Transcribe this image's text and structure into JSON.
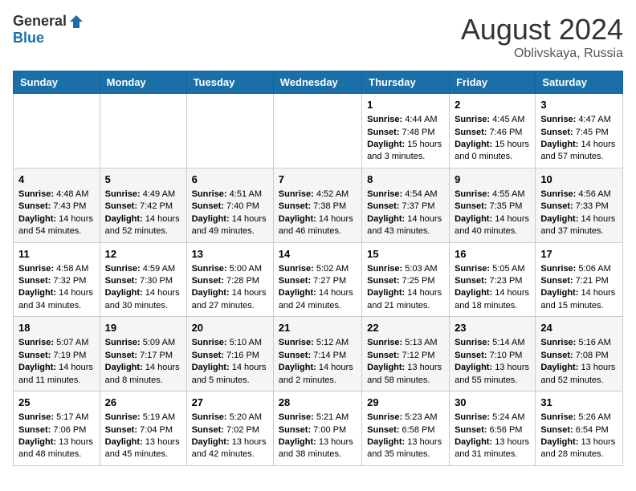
{
  "header": {
    "logo_general": "General",
    "logo_blue": "Blue",
    "month_year": "August 2024",
    "location": "Oblivskaya, Russia"
  },
  "days_of_week": [
    "Sunday",
    "Monday",
    "Tuesday",
    "Wednesday",
    "Thursday",
    "Friday",
    "Saturday"
  ],
  "weeks": [
    [
      {
        "day": "",
        "info": ""
      },
      {
        "day": "",
        "info": ""
      },
      {
        "day": "",
        "info": ""
      },
      {
        "day": "",
        "info": ""
      },
      {
        "day": "1",
        "info": "Sunrise: 4:44 AM\nSunset: 7:48 PM\nDaylight: 15 hours\nand 3 minutes."
      },
      {
        "day": "2",
        "info": "Sunrise: 4:45 AM\nSunset: 7:46 PM\nDaylight: 15 hours\nand 0 minutes."
      },
      {
        "day": "3",
        "info": "Sunrise: 4:47 AM\nSunset: 7:45 PM\nDaylight: 14 hours\nand 57 minutes."
      }
    ],
    [
      {
        "day": "4",
        "info": "Sunrise: 4:48 AM\nSunset: 7:43 PM\nDaylight: 14 hours\nand 54 minutes."
      },
      {
        "day": "5",
        "info": "Sunrise: 4:49 AM\nSunset: 7:42 PM\nDaylight: 14 hours\nand 52 minutes."
      },
      {
        "day": "6",
        "info": "Sunrise: 4:51 AM\nSunset: 7:40 PM\nDaylight: 14 hours\nand 49 minutes."
      },
      {
        "day": "7",
        "info": "Sunrise: 4:52 AM\nSunset: 7:38 PM\nDaylight: 14 hours\nand 46 minutes."
      },
      {
        "day": "8",
        "info": "Sunrise: 4:54 AM\nSunset: 7:37 PM\nDaylight: 14 hours\nand 43 minutes."
      },
      {
        "day": "9",
        "info": "Sunrise: 4:55 AM\nSunset: 7:35 PM\nDaylight: 14 hours\nand 40 minutes."
      },
      {
        "day": "10",
        "info": "Sunrise: 4:56 AM\nSunset: 7:33 PM\nDaylight: 14 hours\nand 37 minutes."
      }
    ],
    [
      {
        "day": "11",
        "info": "Sunrise: 4:58 AM\nSunset: 7:32 PM\nDaylight: 14 hours\nand 34 minutes."
      },
      {
        "day": "12",
        "info": "Sunrise: 4:59 AM\nSunset: 7:30 PM\nDaylight: 14 hours\nand 30 minutes."
      },
      {
        "day": "13",
        "info": "Sunrise: 5:00 AM\nSunset: 7:28 PM\nDaylight: 14 hours\nand 27 minutes."
      },
      {
        "day": "14",
        "info": "Sunrise: 5:02 AM\nSunset: 7:27 PM\nDaylight: 14 hours\nand 24 minutes."
      },
      {
        "day": "15",
        "info": "Sunrise: 5:03 AM\nSunset: 7:25 PM\nDaylight: 14 hours\nand 21 minutes."
      },
      {
        "day": "16",
        "info": "Sunrise: 5:05 AM\nSunset: 7:23 PM\nDaylight: 14 hours\nand 18 minutes."
      },
      {
        "day": "17",
        "info": "Sunrise: 5:06 AM\nSunset: 7:21 PM\nDaylight: 14 hours\nand 15 minutes."
      }
    ],
    [
      {
        "day": "18",
        "info": "Sunrise: 5:07 AM\nSunset: 7:19 PM\nDaylight: 14 hours\nand 11 minutes."
      },
      {
        "day": "19",
        "info": "Sunrise: 5:09 AM\nSunset: 7:17 PM\nDaylight: 14 hours\nand 8 minutes."
      },
      {
        "day": "20",
        "info": "Sunrise: 5:10 AM\nSunset: 7:16 PM\nDaylight: 14 hours\nand 5 minutes."
      },
      {
        "day": "21",
        "info": "Sunrise: 5:12 AM\nSunset: 7:14 PM\nDaylight: 14 hours\nand 2 minutes."
      },
      {
        "day": "22",
        "info": "Sunrise: 5:13 AM\nSunset: 7:12 PM\nDaylight: 13 hours\nand 58 minutes."
      },
      {
        "day": "23",
        "info": "Sunrise: 5:14 AM\nSunset: 7:10 PM\nDaylight: 13 hours\nand 55 minutes."
      },
      {
        "day": "24",
        "info": "Sunrise: 5:16 AM\nSunset: 7:08 PM\nDaylight: 13 hours\nand 52 minutes."
      }
    ],
    [
      {
        "day": "25",
        "info": "Sunrise: 5:17 AM\nSunset: 7:06 PM\nDaylight: 13 hours\nand 48 minutes."
      },
      {
        "day": "26",
        "info": "Sunrise: 5:19 AM\nSunset: 7:04 PM\nDaylight: 13 hours\nand 45 minutes."
      },
      {
        "day": "27",
        "info": "Sunrise: 5:20 AM\nSunset: 7:02 PM\nDaylight: 13 hours\nand 42 minutes."
      },
      {
        "day": "28",
        "info": "Sunrise: 5:21 AM\nSunset: 7:00 PM\nDaylight: 13 hours\nand 38 minutes."
      },
      {
        "day": "29",
        "info": "Sunrise: 5:23 AM\nSunset: 6:58 PM\nDaylight: 13 hours\nand 35 minutes."
      },
      {
        "day": "30",
        "info": "Sunrise: 5:24 AM\nSunset: 6:56 PM\nDaylight: 13 hours\nand 31 minutes."
      },
      {
        "day": "31",
        "info": "Sunrise: 5:26 AM\nSunset: 6:54 PM\nDaylight: 13 hours\nand 28 minutes."
      }
    ]
  ]
}
